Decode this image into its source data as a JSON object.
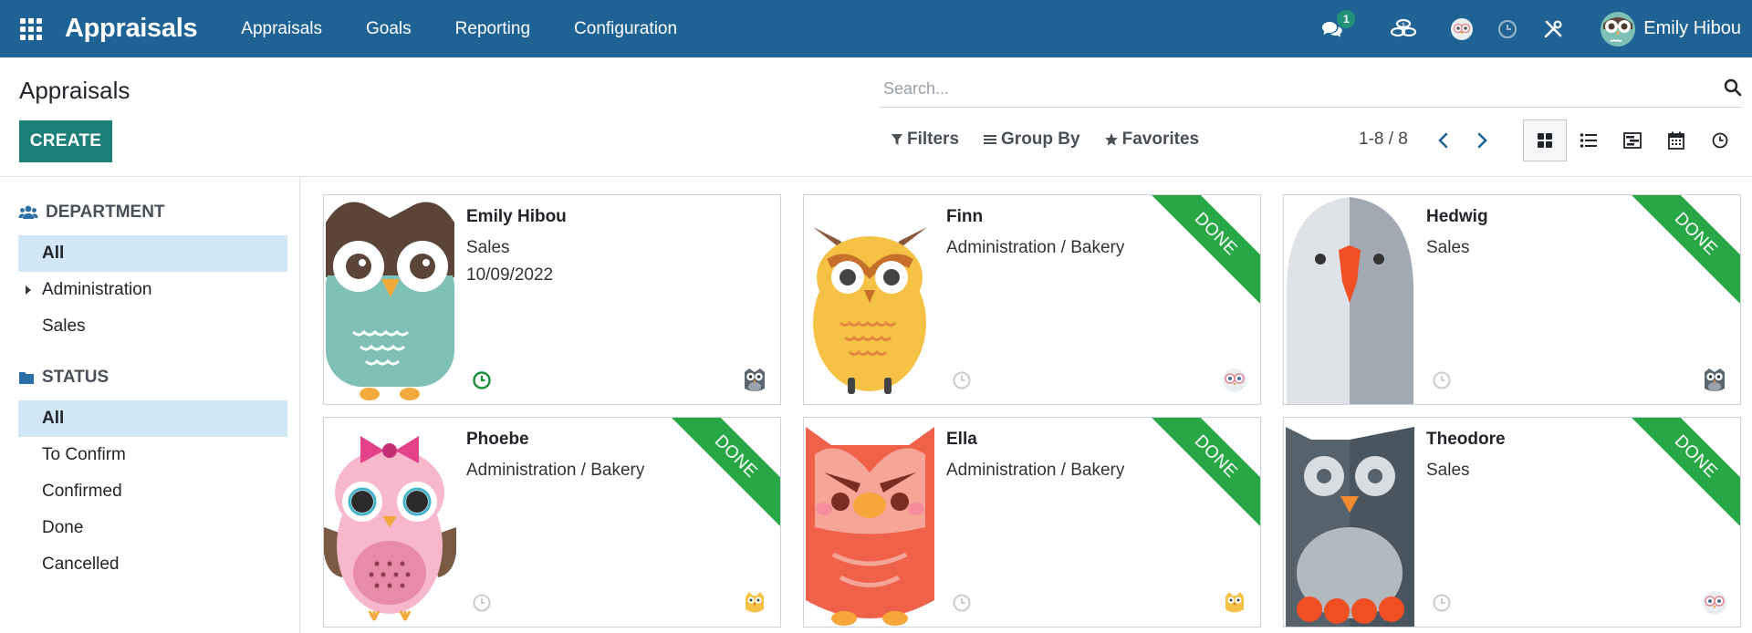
{
  "navbar": {
    "brand": "Appraisals",
    "menu": [
      "Appraisals",
      "Goals",
      "Reporting",
      "Configuration"
    ],
    "messages_badge": "1",
    "user_name": "Emily Hibou",
    "icons": [
      "apps-grid-icon",
      "chat-icon",
      "dollar-coins-icon",
      "owl-avatar-icon",
      "clock-icon",
      "tools-icon"
    ]
  },
  "control_panel": {
    "title": "Appraisals",
    "create_label": "CREATE",
    "search_placeholder": "Search...",
    "filters_label": "Filters",
    "groupby_label": "Group By",
    "favorites_label": "Favorites",
    "pager": "1-8 / 8",
    "views": [
      "kanban",
      "list",
      "gantt",
      "calendar",
      "activity"
    ],
    "active_view": "kanban"
  },
  "sidepanel": {
    "department": {
      "header": "DEPARTMENT",
      "items": [
        {
          "label": "All",
          "active": true
        },
        {
          "label": "Administration",
          "active": false,
          "expandable": true
        },
        {
          "label": "Sales",
          "active": false
        }
      ]
    },
    "status": {
      "header": "STATUS",
      "items": [
        {
          "label": "All",
          "active": true
        },
        {
          "label": "To Confirm",
          "active": false
        },
        {
          "label": "Confirmed",
          "active": false
        },
        {
          "label": "Done",
          "active": false
        },
        {
          "label": "Cancelled",
          "active": false
        }
      ]
    }
  },
  "cards": [
    {
      "name": "Emily Hibou",
      "department": "Sales",
      "date": "10/09/2022",
      "ribbon": "",
      "activity": "planned"
    },
    {
      "name": "Finn",
      "department": "Administration / Bakery",
      "date": "",
      "ribbon": "DONE",
      "activity": "none"
    },
    {
      "name": "Hedwig",
      "department": "Sales",
      "date": "",
      "ribbon": "DONE",
      "activity": "none"
    },
    {
      "name": "Phoebe",
      "department": "Administration / Bakery",
      "date": "",
      "ribbon": "DONE",
      "activity": "none"
    },
    {
      "name": "Ella",
      "department": "Administration / Bakery",
      "date": "",
      "ribbon": "DONE",
      "activity": "none"
    },
    {
      "name": "Theodore",
      "department": "Sales",
      "date": "",
      "ribbon": "DONE",
      "activity": "none"
    }
  ],
  "colors": {
    "navbar": "#1f6394",
    "primary_button": "#1d8077",
    "ribbon_done": "#28a745",
    "active_filter": "#d2e7f5"
  }
}
